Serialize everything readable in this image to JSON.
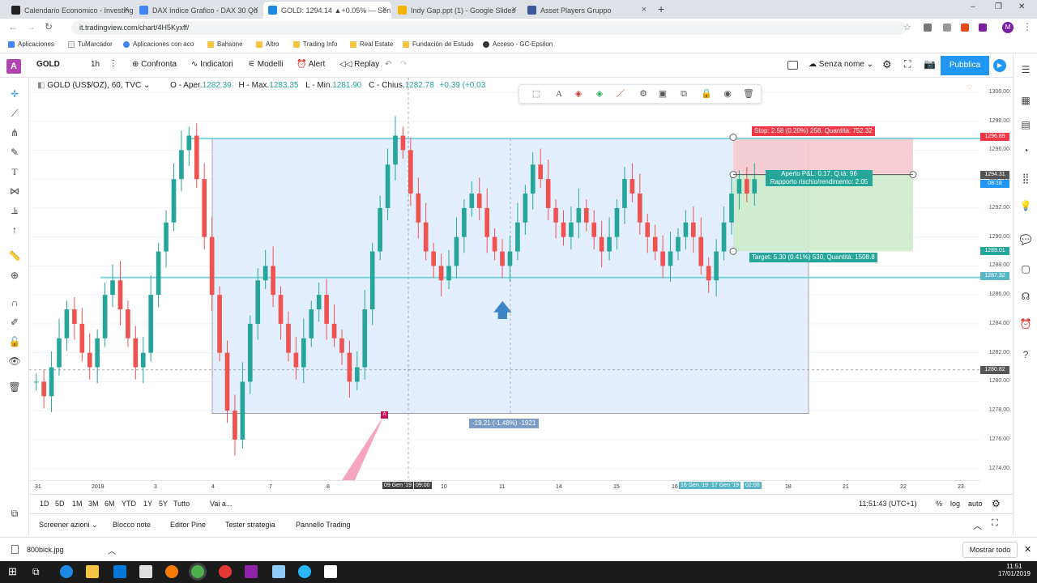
{
  "browser": {
    "tabs": [
      {
        "title": "Calendario Economico - Investing",
        "favicon_color": "#222222"
      },
      {
        "title": "DAX Indice Grafico - DAX 30 Qu",
        "favicon_color": "#4285f4"
      },
      {
        "title": "GOLD: 1294.14 ▲+0.05% — Sen",
        "favicon_color": "#1e88e5"
      },
      {
        "title": "Indy Gap.ppt (1) - Google Slides",
        "favicon_color": "#f4b400"
      },
      {
        "title": "Asset Players Gruppo",
        "favicon_color": "#3b5998"
      }
    ],
    "new_tab": "+",
    "url": "it.tradingview.com/chart/4H5Kyxff/",
    "bookmarks": [
      "Aplicaciones",
      "TuMarcador",
      "Aplicaciones con aco",
      "Bahsone",
      "Altro",
      "Trading Info",
      "Real Estate",
      "Fundación de Estudo",
      "Acceso - GC-Epsilon"
    ],
    "window_controls": [
      "–",
      "❐",
      "✕"
    ]
  },
  "tv_header": {
    "logo": "A",
    "symbol": "GOLD",
    "interval": "1h",
    "compare_label": "Confronta",
    "indicators_label": "Indicatori",
    "templates_label": "Modelli",
    "alert_label": "Alert",
    "replay_label": "Replay",
    "layout_name": "Senza nome",
    "publish_label": "Pubblica"
  },
  "legend": {
    "instrument": "GOLD (US$/OZ), 60, TVC",
    "open_label": "O - Aper.",
    "open": "1282.39",
    "high_label": "H - Max.",
    "high": "1283.35",
    "low_label": "L - Min.",
    "low": "1281.90",
    "close_label": "C - Chius.",
    "close": "1282.78",
    "change": "+0.39 (+0.03"
  },
  "position": {
    "stop_label": "Stop: 2.58 (0.20%) 258, Quantità: 752.32",
    "open_label": "Aperto P&L: 0.17, Q.tà: 96",
    "ratio_label": "Rapporto rischio/rendimento: 2.05",
    "target_label": "Target: 5.30 (0.41%) 530, Quantità: 1508.8"
  },
  "measure_label": "-19.21 (-1.48%) -1921",
  "chart_data": {
    "type": "candlestick",
    "title": "GOLD (US$/OZ), 60, TVC",
    "y_ticks": [
      "1300.00",
      "1298.00",
      "1296.00",
      "1294.00",
      "1292.00",
      "1290.00",
      "1288.00",
      "1286.00",
      "1284.00",
      "1282.00",
      "1280.00",
      "1278.00",
      "1276.00",
      "1274.00"
    ],
    "ylim": [
      1273.2,
      1301.0
    ],
    "x_ticks": [
      "31",
      "2019",
      "3",
      "4",
      "7",
      "8",
      "9",
      "10",
      "11",
      "14",
      "15",
      "16",
      "17",
      "18",
      "21",
      "22",
      "23"
    ],
    "price_labels": {
      "stop": "1296.89",
      "current": "1294.31",
      "countdown": "08:18",
      "target": "1289.01",
      "support": "1287.32",
      "crosshair": "1280.82"
    },
    "time_labels": [
      "09 Gen '19",
      "09:00",
      "16 Gen '19",
      "17 Gen '19",
      "02:00"
    ],
    "horizontal_lines": [
      1296.8,
      1287.2
    ],
    "rectangle_range": [
      1277.8,
      1296.8
    ],
    "close_series": [
      1280,
      1279,
      1281,
      1283,
      1285,
      1284,
      1282,
      1281,
      1283,
      1286,
      1287,
      1285,
      1283,
      1281,
      1282,
      1286,
      1289,
      1291,
      1294,
      1296,
      1297,
      1294,
      1290,
      1286,
      1282,
      1278,
      1276,
      1280,
      1284,
      1287,
      1288,
      1286,
      1284,
      1282,
      1281,
      1283,
      1285,
      1286,
      1284,
      1283,
      1282,
      1280,
      1281,
      1285,
      1289,
      1292,
      1295,
      1297,
      1296,
      1293,
      1291,
      1289,
      1288,
      1287,
      1288,
      1290,
      1292,
      1293,
      1292,
      1290,
      1289,
      1288,
      1289,
      1291,
      1293,
      1295,
      1294,
      1292,
      1291,
      1290,
      1291,
      1292,
      1291,
      1290,
      1289,
      1290,
      1292,
      1294,
      1293,
      1291,
      1290,
      1289,
      1288,
      1289,
      1290,
      1291,
      1290,
      1288,
      1287,
      1289,
      1291,
      1293,
      1294,
      1293,
      1294
    ]
  },
  "time_range": {
    "buttons": [
      "1D",
      "5D",
      "1M",
      "3M",
      "6M",
      "YTD",
      "1Y",
      "5Y",
      "Tutto"
    ],
    "goto": "Vai a...",
    "clock": "11:51:43 (UTC+1)",
    "percent": "%",
    "log": "log",
    "auto": "auto"
  },
  "panels": [
    "Screener azioni",
    "Blocco note",
    "Editor Pine",
    "Tester strategia",
    "Pannello Trading"
  ],
  "download": {
    "file": "800bick.jpg",
    "show_all": "Mostrar todo"
  },
  "taskbar": {
    "time": "11:51",
    "date": "17/01/2019"
  }
}
